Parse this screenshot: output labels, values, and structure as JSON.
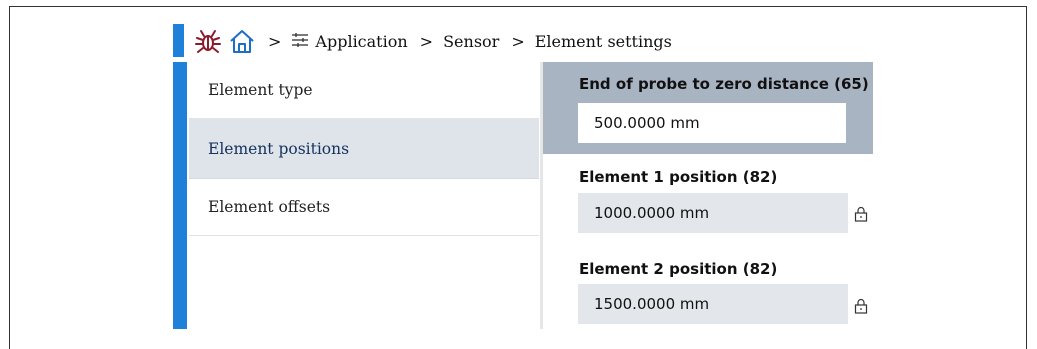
{
  "breadcrumb": {
    "items": [
      "Application",
      "Sensor",
      "Element settings"
    ],
    "separator": ">"
  },
  "nav": {
    "items": [
      {
        "label": "Element type"
      },
      {
        "label": "Element positions",
        "active": true
      },
      {
        "label": "Element offsets"
      }
    ]
  },
  "params": {
    "end_of_probe": {
      "label": "End of probe to zero distance (65)",
      "value": "500.0000 mm"
    },
    "element1": {
      "label": "Element 1 position (82)",
      "value": "1000.0000 mm"
    },
    "element2": {
      "label": "Element 2 position (82)",
      "value": "1500.0000 mm"
    }
  },
  "colors": {
    "accent": "#1e80d8",
    "header_panel": "#a9b4c3",
    "active_nav": "#dfe3ea",
    "readonly_field": "#e3e6eb"
  },
  "icons": [
    "bug-icon",
    "home-icon",
    "settings-sliders-icon",
    "lock-icon"
  ]
}
